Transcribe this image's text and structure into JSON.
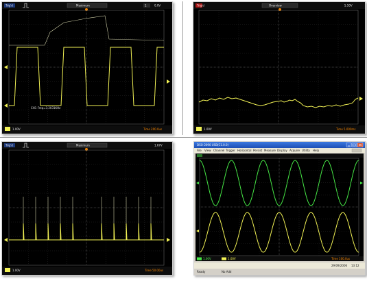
{
  "colors": {
    "ch1_yellow": "#f2f255",
    "ch2_green": "#46e846",
    "grid": "#444444",
    "accent_orange": "#ff8a00"
  },
  "scope_tl": {
    "trig_tag": "Trig'd",
    "mode_label": "Maximum",
    "ch1_marker": "1",
    "voltage_readout": "0.0V",
    "scale_label": "1.00V",
    "time_label": "Time 200.0us",
    "measure_label": "CH1 Freq=3.2031KHz"
  },
  "scope_tr": {
    "trig_tag": "Trig'd",
    "mode_label": "Overview",
    "voltage_readout": "5.50V",
    "scale_label": "1.00V",
    "time_label": "Time 5.000ms"
  },
  "scope_bl": {
    "trig_tag": "Trig'd",
    "mode_label": "Maximum",
    "voltage_readout": "1.67V",
    "scale_label": "1.00V",
    "time_label": "Time 50.00us"
  },
  "scope_win": {
    "title": "DSO-2090 USB(C1.0.0)",
    "menu": [
      "File",
      "View",
      "Channel",
      "Trigger",
      "Horizontal",
      "Persist",
      "Measure",
      "Display",
      "Acquire",
      "Utility",
      "Help"
    ],
    "ch1_scale": "1.00V",
    "ch2_scale": "1.00V",
    "time_label": "Time 100.0us",
    "date": "29/09/2006",
    "clock": "13:12",
    "status_ready": "Ready",
    "status_field": "No Add"
  }
}
